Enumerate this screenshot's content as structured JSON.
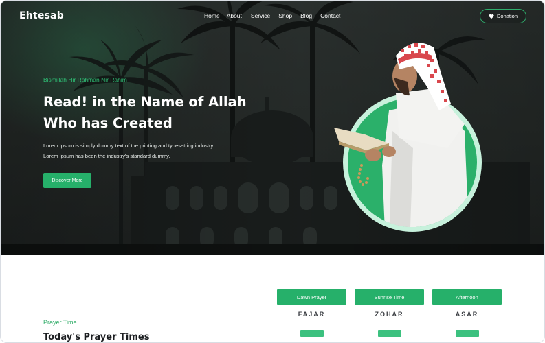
{
  "brand": {
    "name": "Ehtesab"
  },
  "nav": {
    "items": [
      {
        "label": "Home"
      },
      {
        "label": "About"
      },
      {
        "label": "Service"
      },
      {
        "label": "Shop"
      },
      {
        "label": "Blog"
      },
      {
        "label": "Contact"
      }
    ],
    "donation_label": "Donation",
    "donation_icon": "heart-icon"
  },
  "hero": {
    "subtitle": "Bismillah Hir Rahman Nir Rahim",
    "title_line1": "Read! in the Name of Allah",
    "title_line2": "Who has Created",
    "desc_line1": "Lorem Ipsum is simply dummy text of the printing and typesetting industry.",
    "desc_line2": "Lorem Ipsum has been the industry's standard dummy.",
    "cta_label": "Discover More"
  },
  "prayer": {
    "label": "Prayer Time",
    "heading": "Today's Prayer Times",
    "cards": [
      {
        "title": "Dawn Prayer",
        "name": "FAJAR"
      },
      {
        "title": "Sunrise Time",
        "name": "ZOHAR"
      },
      {
        "title": "Afternoon",
        "name": "ASAR"
      }
    ]
  },
  "colors": {
    "accent": "#26b06a",
    "hero_bg": "#262b29",
    "text_dark": "#1b1d20"
  }
}
